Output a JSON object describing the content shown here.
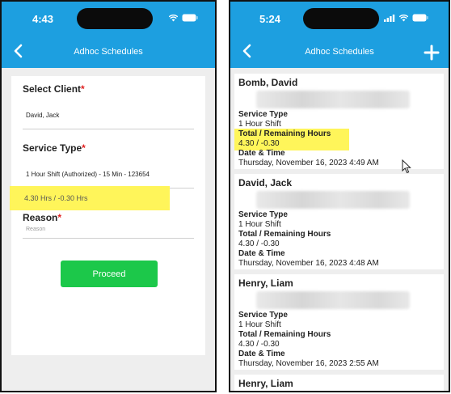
{
  "left_screen": {
    "status": {
      "time": "4:43"
    },
    "nav": {
      "title": "Adhoc Schedules"
    },
    "form": {
      "client_label": "Select Client",
      "client_value": "David, Jack",
      "service_label": "Service Type",
      "service_value": "1 Hour Shift (Authorized) - 15 Min - 123654",
      "hours_text": "4.30 Hrs / -0.30 Hrs",
      "reason_label": "Reason",
      "reason_placeholder": "Reason",
      "required_mark": "*",
      "proceed_label": "Proceed"
    }
  },
  "right_screen": {
    "status": {
      "time": "5:24"
    },
    "nav": {
      "title": "Adhoc Schedules"
    },
    "cards": [
      {
        "name": "Bomb, David",
        "service_label": "Service Type",
        "service_value": "1 Hour Shift",
        "hours_label": "Total / Remaining Hours",
        "hours_value": "4.30 / -0.30",
        "date_label": "Date & Time",
        "date_value": "Thursday, November 16, 2023 4:49 AM"
      },
      {
        "name": "David, Jack",
        "service_label": "Service Type",
        "service_value": "1 Hour Shift",
        "hours_label": "Total / Remaining Hours",
        "hours_value": "4.30 / -0.30",
        "date_label": "Date & Time",
        "date_value": "Thursday, November 16, 2023 4:48 AM"
      },
      {
        "name": "Henry, Liam",
        "service_label": "Service Type",
        "service_value": "1 Hour Shift",
        "hours_label": "Total / Remaining Hours",
        "hours_value": "4.30 / -0.30",
        "date_label": "Date & Time",
        "date_value": "Thursday, November 16, 2023 2:55 AM"
      },
      {
        "name": "Henry, Liam"
      }
    ]
  },
  "colors": {
    "header_blue": "#1d9fe0",
    "proceed_green": "#1cc84a",
    "highlight_yellow": "#fff55a",
    "required_red": "#e02020"
  },
  "icons": [
    "back-chevron-icon",
    "add-plus-icon",
    "wifi-icon",
    "signal-icon",
    "battery-icon",
    "mouse-cursor-icon"
  ]
}
